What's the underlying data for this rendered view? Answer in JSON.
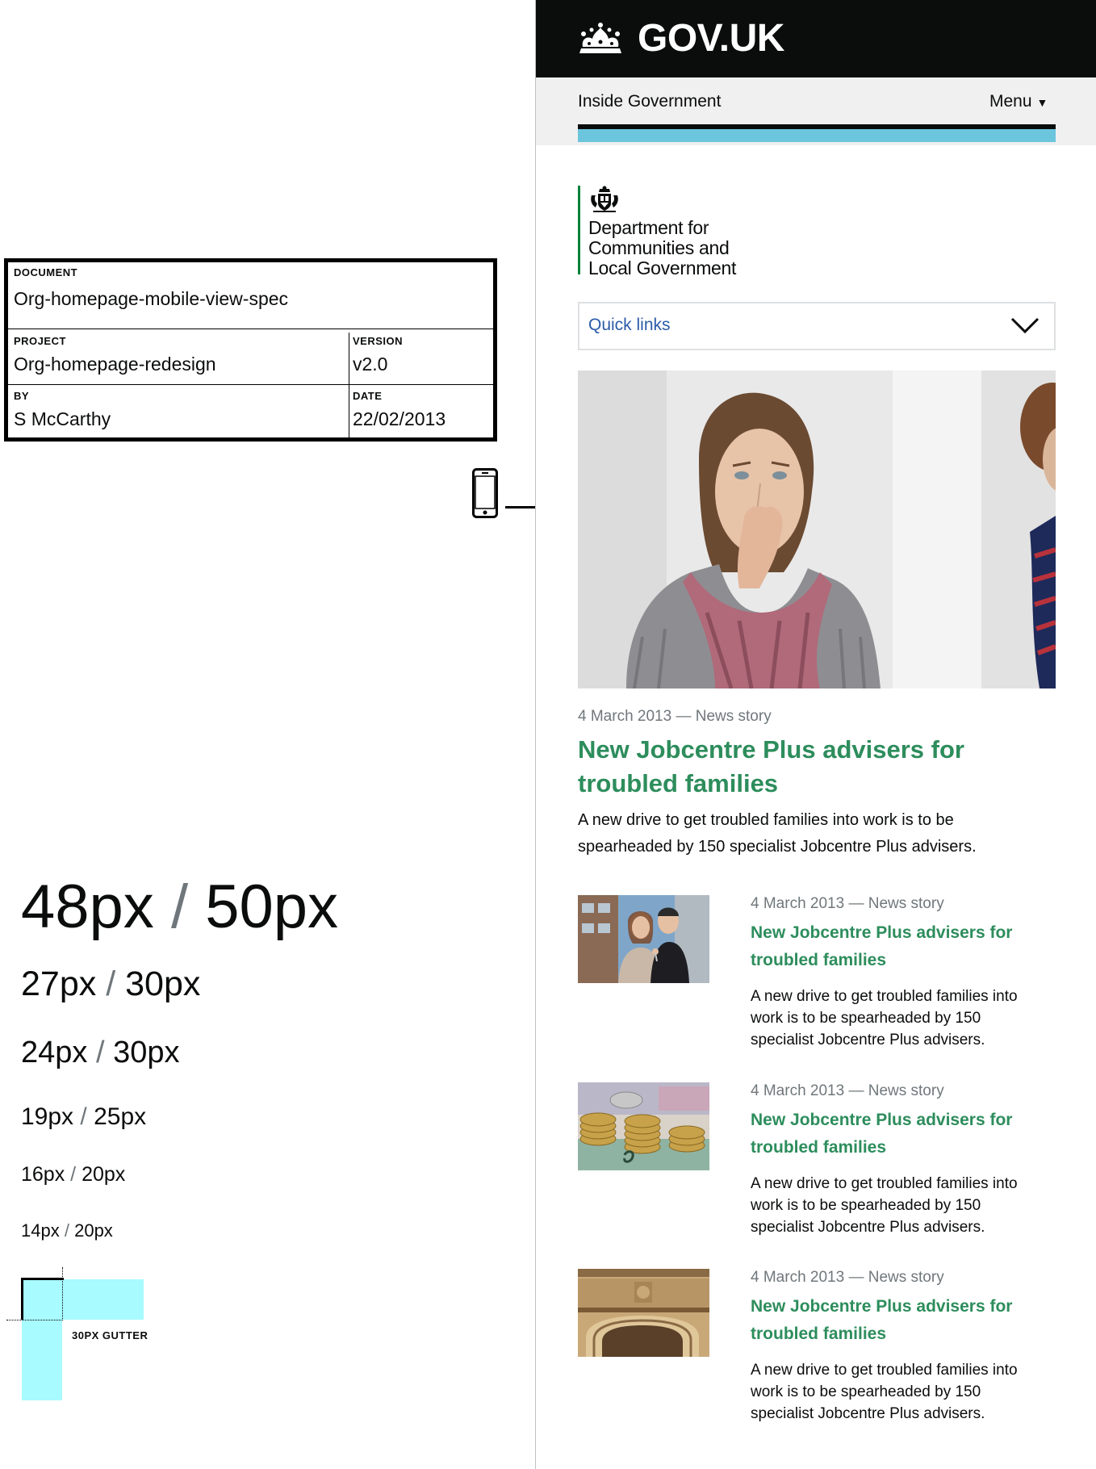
{
  "spec": {
    "document_label": "DOCUMENT",
    "document_value": "Org-homepage-mobile-view-spec",
    "project_label": "PROJECT",
    "project_value": "Org-homepage-redesign",
    "version_label": "VERSION",
    "version_value": "v2.0",
    "by_label": "BY",
    "by_value": "S McCarthy",
    "date_label": "DATE",
    "date_value": "22/02/2013"
  },
  "type_scale": [
    {
      "size": "48px",
      "line": "50px"
    },
    {
      "size": "27px",
      "line": "30px"
    },
    {
      "size": "24px",
      "line": "30px"
    },
    {
      "size": "19px",
      "line": "25px"
    },
    {
      "size": "16px",
      "line": "20px"
    },
    {
      "size": "14px",
      "line": "20px"
    }
  ],
  "gutter_label": "30PX GUTTER",
  "header": {
    "logotype": "GOV.UK"
  },
  "subnav": {
    "title": "Inside Government",
    "menu_label": "Menu",
    "menu_arrow": "▼"
  },
  "org": {
    "name_line1": "Department for",
    "name_line2": "Communities and",
    "name_line3": "Local Government"
  },
  "quick_links": {
    "label": "Quick links"
  },
  "featured": {
    "meta": "4 March 2013 — News story",
    "title": "New Jobcentre Plus advisers for troubled families",
    "summary": "A new drive to get troubled families into work is to be spearheaded by 150 specialist Jobcentre Plus advisers."
  },
  "stories": [
    {
      "meta": "4 March 2013 — News story",
      "title": "New Jobcentre Plus advisers for troubled families",
      "summary": "A new drive to get troubled families into work is to be spearheaded by 150 specialist Jobcentre Plus advisers.",
      "thumb": "couple-with-keys"
    },
    {
      "meta": "4 March 2013 — News story",
      "title": "New Jobcentre Plus advisers for troubled families",
      "summary": "A new drive to get troubled families into work is to be spearheaded by 150 specialist Jobcentre Plus advisers.",
      "thumb": "coins-and-banknotes"
    },
    {
      "meta": "4 March 2013 — News story",
      "title": "New Jobcentre Plus advisers for troubled families",
      "summary": "A new drive to get troubled families into work is to be spearheaded by 150 specialist Jobcentre Plus advisers.",
      "thumb": "town-hall-facade"
    }
  ],
  "colors": {
    "header_bg": "#0b0c0c",
    "link_green": "#2d8d5c",
    "accent_blue": "#6bc5dd",
    "quick_link_blue": "#2b5ca8",
    "org_rule_green": "#00823b",
    "gutter_cyan": "#a8fbff"
  }
}
